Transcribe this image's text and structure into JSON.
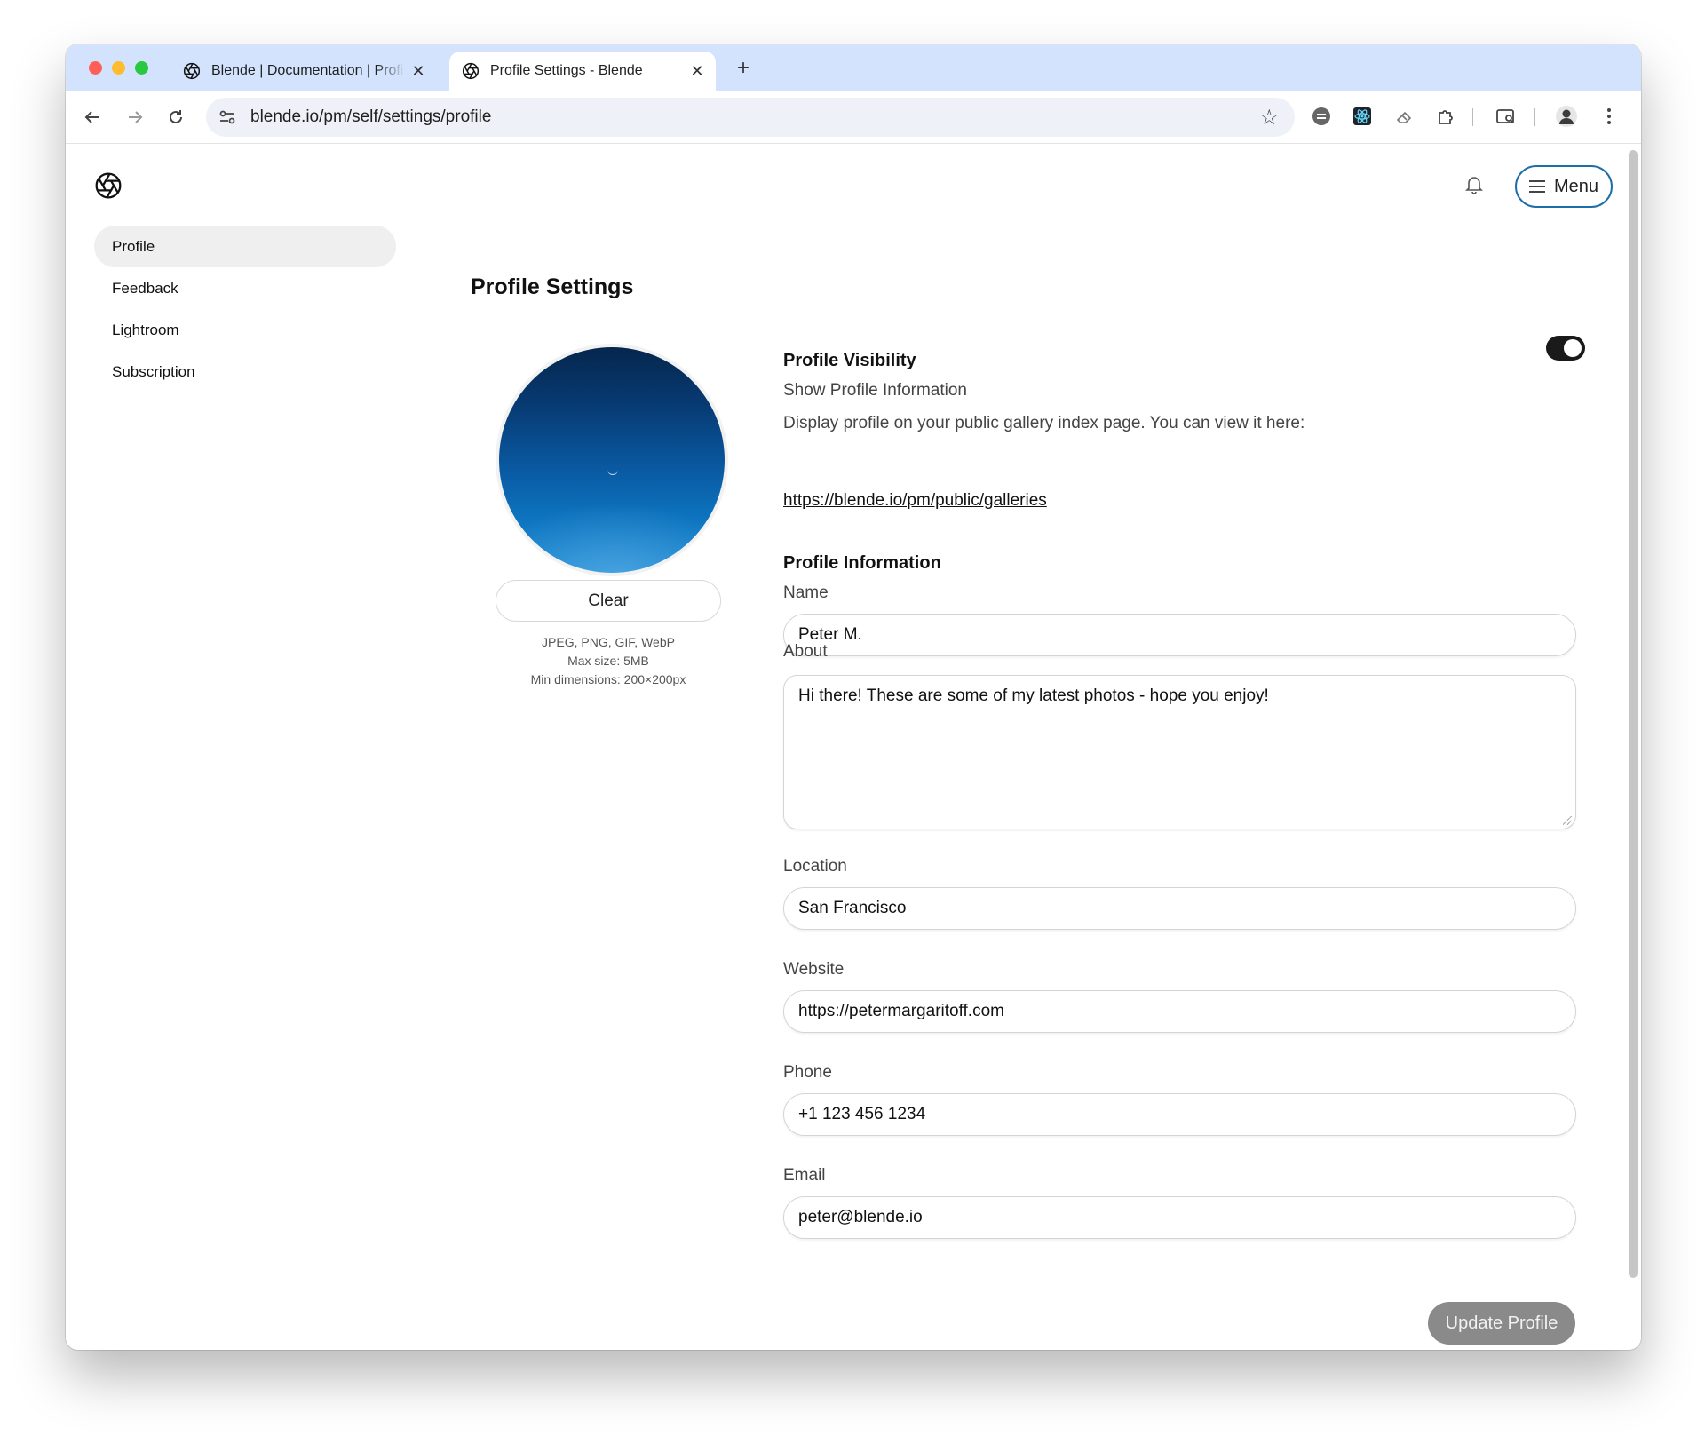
{
  "browser": {
    "tabs": [
      {
        "title": "Blende | Documentation | Profile",
        "close": "✕"
      },
      {
        "title": "Profile Settings - Blende",
        "close": "✕"
      }
    ],
    "new_tab": "+",
    "url": "blende.io/pm/self/settings/profile"
  },
  "header": {
    "menu_label": "Menu"
  },
  "sidebar": {
    "items": [
      {
        "label": "Profile"
      },
      {
        "label": "Feedback"
      },
      {
        "label": "Lightroom"
      },
      {
        "label": "Subscription"
      }
    ]
  },
  "main": {
    "title": "Profile Settings",
    "avatar": {
      "clear_label": "Clear",
      "formats": "JPEG, PNG, GIF, WebP",
      "max_size": "Max size: 5MB",
      "min_dimensions": "Min dimensions: 200×200px"
    },
    "visibility": {
      "title": "Profile Visibility",
      "toggle_label": "Show Profile Information",
      "toggle_on": true,
      "description": "Display profile on your public gallery index page. You can view it here:",
      "link": "https://blende.io/pm/public/galleries"
    },
    "info": {
      "title": "Profile Information",
      "name_label": "Name",
      "name_value": "Peter M.",
      "about_label": "About",
      "about_value": "Hi there! These are some of my latest photos - hope you enjoy!",
      "location_label": "Location",
      "location_value": "San Francisco",
      "website_label": "Website",
      "website_value": "https://petermargaritoff.com",
      "phone_label": "Phone",
      "phone_value": "+1 123 456 1234",
      "email_label": "Email",
      "email_value": "peter@blende.io"
    },
    "update_label": "Update Profile"
  },
  "colors": {
    "accent_border": "#1e6fa8",
    "tabstrip": "#d3e3fd",
    "button_disabled": "#8a8a8a"
  }
}
